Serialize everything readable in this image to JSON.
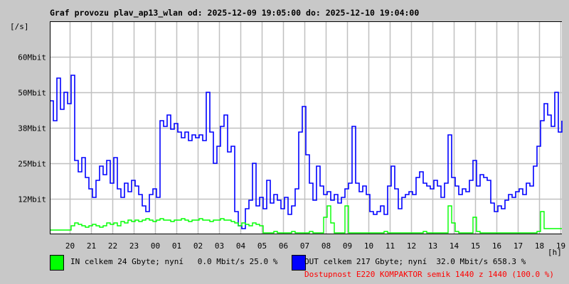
{
  "colors": {
    "background": "#c8c8c8",
    "plot": "#ffffff",
    "grid": "#c0c0c0",
    "in": "#00ff00",
    "out": "#0000ff",
    "availability": "#ff0000"
  },
  "chart_data": {
    "type": "line",
    "title": "Graf provozu plav_ap13_wlan od: 2025-12-09 19:05:00 do: 2025-12-10 19:04:00",
    "ylabel": "[/s]",
    "xlabel": "[h]",
    "ylim": [
      0,
      75
    ],
    "y_unit": "Mbit/s",
    "y_ticks": [
      {
        "value": 12.5,
        "label": "12Mbit"
      },
      {
        "value": 25,
        "label": "25Mbit"
      },
      {
        "value": 37.5,
        "label": "38Mbit"
      },
      {
        "value": 50,
        "label": "50Mbit"
      },
      {
        "value": 62.5,
        "label": "60Mbit"
      }
    ],
    "x_range_hours": [
      19.083,
      43.083
    ],
    "x_sample_minutes": 10,
    "x_ticks": [
      "20",
      "21",
      "22",
      "23",
      "00",
      "01",
      "02",
      "03",
      "04",
      "05",
      "06",
      "07",
      "08",
      "09",
      "10",
      "11",
      "12",
      "13",
      "14",
      "15",
      "16",
      "17",
      "18",
      "19"
    ],
    "grid": true,
    "series": [
      {
        "name": "OUT",
        "values": [
          47,
          40,
          55,
          44,
          50,
          46,
          56,
          26,
          22,
          27,
          20,
          16,
          13,
          19,
          24,
          21,
          26,
          18,
          27,
          16,
          13,
          18,
          15,
          19,
          17,
          14,
          10,
          8,
          14,
          16,
          13,
          40,
          38,
          42,
          37,
          39,
          36,
          34,
          36,
          33,
          35,
          34,
          35,
          33,
          50,
          36,
          25,
          31,
          38,
          42,
          29,
          31,
          8,
          3,
          2,
          9,
          12,
          25,
          10,
          13,
          9,
          19,
          11,
          14,
          12,
          9,
          13,
          7,
          10,
          16,
          36,
          45,
          28,
          18,
          12,
          24,
          17,
          14,
          15,
          12,
          14,
          11,
          13,
          16,
          18,
          38,
          18,
          15,
          17,
          14,
          8,
          7,
          8,
          10,
          7,
          17,
          24,
          16,
          9,
          13,
          14,
          15,
          14,
          20,
          22,
          18,
          17,
          16,
          19,
          17,
          13,
          18,
          35,
          20,
          17,
          14,
          16,
          15,
          19,
          26,
          17,
          21,
          20,
          19,
          11,
          8,
          10,
          9,
          12,
          14,
          13,
          15,
          16,
          14,
          18,
          17,
          24,
          31,
          40,
          46,
          42,
          38,
          50,
          36,
          40
        ]
      },
      {
        "name": "IN",
        "values": [
          1.5,
          1.5,
          1.5,
          1.5,
          1.5,
          1.5,
          3,
          4,
          3.5,
          3,
          2.5,
          3,
          3.5,
          3,
          2.5,
          3,
          4,
          3.5,
          4,
          3,
          4.5,
          4,
          5,
          4.5,
          5,
          4.5,
          5,
          5.5,
          5,
          4.5,
          5,
          5.5,
          5,
          5,
          4.5,
          5,
          5,
          5.5,
          5,
          4.5,
          5,
          5,
          5.5,
          5,
          5,
          4.5,
          5,
          5,
          5.5,
          5,
          5,
          4.5,
          4,
          3,
          4,
          3.5,
          3,
          4,
          3.5,
          3,
          0.5,
          0.5,
          0.5,
          1,
          0.5,
          0.5,
          0.5,
          0.5,
          1,
          0.5,
          0.5,
          0.5,
          0.5,
          1,
          0.5,
          0.5,
          0.5,
          6,
          10,
          4,
          0.5,
          0.5,
          0.5,
          10,
          0.5,
          0.5,
          0.5,
          0.5,
          0.5,
          0.5,
          0.5,
          0.5,
          0.5,
          0.5,
          1,
          0.5,
          0.5,
          0.5,
          0.5,
          0.5,
          0.5,
          0.5,
          0.5,
          0.5,
          0.5,
          1,
          0.5,
          0.5,
          0.5,
          0.5,
          0.5,
          0.5,
          10,
          4,
          1,
          0.5,
          0.5,
          0.5,
          0.5,
          6,
          1,
          0.5,
          0.5,
          0.5,
          0.5,
          0.5,
          0.5,
          0.5,
          0.5,
          0.5,
          0.5,
          0.5,
          0.5,
          0.5,
          0.5,
          0.5,
          0.5,
          1,
          8,
          2,
          2,
          2,
          2,
          2,
          2
        ]
      }
    ]
  },
  "legend": {
    "in_text": "IN celkem 24 Gbyte; nyní   0.0 Mbit/s 25.0 %",
    "out_text": "OUT celkem 217 Gbyte; nyní  32.0 Mbit/s 658.3 %",
    "availability_text": "Dostupnost E220 KOMPAKTOR semik 1440 z 1440 (100.0 %)"
  }
}
